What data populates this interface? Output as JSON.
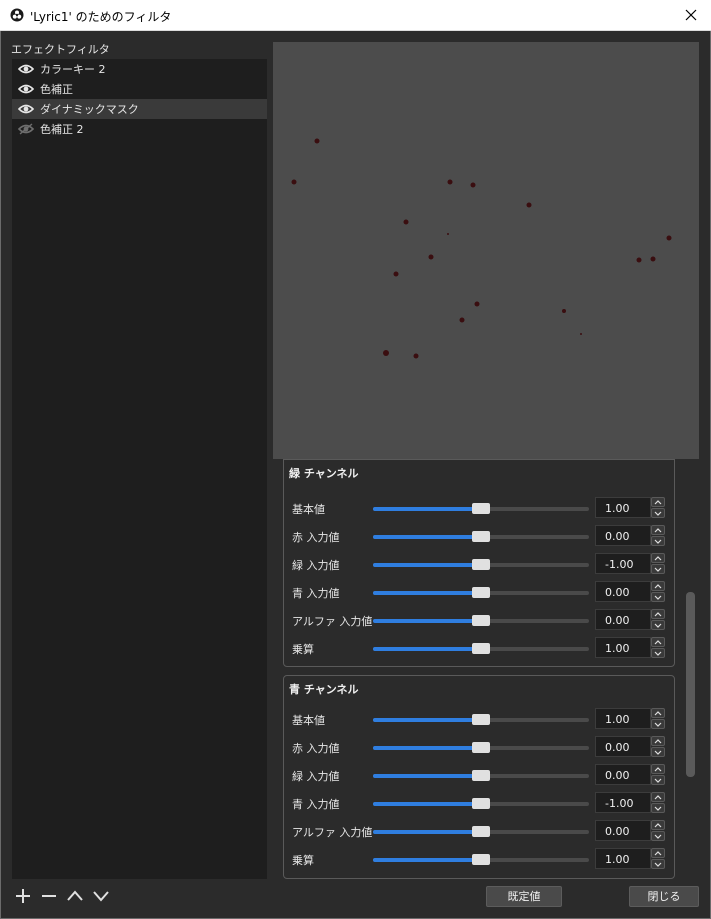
{
  "window": {
    "title": "'Lyric1' のためのフィルタ"
  },
  "filters": {
    "label": "エフェクトフィルタ",
    "items": [
      {
        "label": "カラーキー 2",
        "visible": true,
        "selected": false
      },
      {
        "label": "色補正",
        "visible": true,
        "selected": false
      },
      {
        "label": "ダイナミックマスク",
        "visible": true,
        "selected": true
      },
      {
        "label": "色補正 2",
        "visible": false,
        "selected": false
      }
    ]
  },
  "groups": [
    {
      "title": "緑 チャンネル",
      "rows": [
        {
          "label": "基本値",
          "value": "1.00",
          "slider": 0.5
        },
        {
          "label": "赤 入力値",
          "value": "0.00",
          "slider": 0.5
        },
        {
          "label": "緑 入力値",
          "value": "-1.00",
          "slider": 0.5
        },
        {
          "label": "青 入力値",
          "value": "0.00",
          "slider": 0.5
        },
        {
          "label": "アルファ 入力値",
          "value": "0.00",
          "slider": 0.5
        },
        {
          "label": "乗算",
          "value": "1.00",
          "slider": 0.5
        }
      ]
    },
    {
      "title": "青 チャンネル",
      "rows": [
        {
          "label": "基本値",
          "value": "1.00",
          "slider": 0.5
        },
        {
          "label": "赤 入力値",
          "value": "0.00",
          "slider": 0.5
        },
        {
          "label": "緑 入力値",
          "value": "0.00",
          "slider": 0.5
        },
        {
          "label": "青 入力値",
          "value": "-1.00",
          "slider": 0.5
        },
        {
          "label": "アルファ 入力値",
          "value": "0.00",
          "slider": 0.5
        },
        {
          "label": "乗算",
          "value": "1.00",
          "slider": 0.5
        }
      ]
    }
  ],
  "buttons": {
    "defaults": "既定値",
    "close": "閉じる"
  },
  "icons": {
    "add": "plus-icon",
    "remove": "minus-icon",
    "up": "chevron-up-icon",
    "down": "chevron-down-icon"
  },
  "colors": {
    "accent": "#2f7ee0",
    "preview_bg": "#4c4c4c"
  }
}
